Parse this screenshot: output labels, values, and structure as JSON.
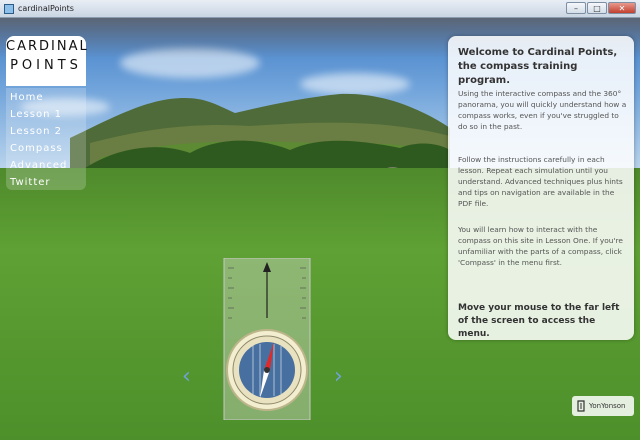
{
  "window": {
    "title": "cardinalPoints",
    "minimize": "–",
    "maximize": "□",
    "close": "✕"
  },
  "logo": {
    "line1": "CARDINAL",
    "line2": "POINTS"
  },
  "menu": {
    "items": [
      {
        "label": "Home",
        "active": true
      },
      {
        "label": "Lesson 1"
      },
      {
        "label": "Lesson 2"
      },
      {
        "label": "Compass"
      },
      {
        "label": "Advanced"
      },
      {
        "label": "Twitter"
      }
    ]
  },
  "panel": {
    "title": "Welcome to Cardinal Points, the compass training program.",
    "para1": "Using the interactive compass and the 360° panorama, you will quickly understand how a compass works, even if you've struggled to do so in the past.",
    "para2": "Follow the instructions carefully in each lesson. Repeat each simulation until you understand. Advanced techniques plus hints and tips on navigation are available in the PDF file.",
    "para3": "You will learn how to interact with the compass on this site in Lesson One. If you're unfamiliar with the parts of a compass, click 'Compass' in the menu first.",
    "footer": "Move your mouse to the far left of the screen to access the menu."
  },
  "nav": {
    "left": "‹",
    "right": "›"
  },
  "brand": {
    "label": "YonYonson"
  }
}
